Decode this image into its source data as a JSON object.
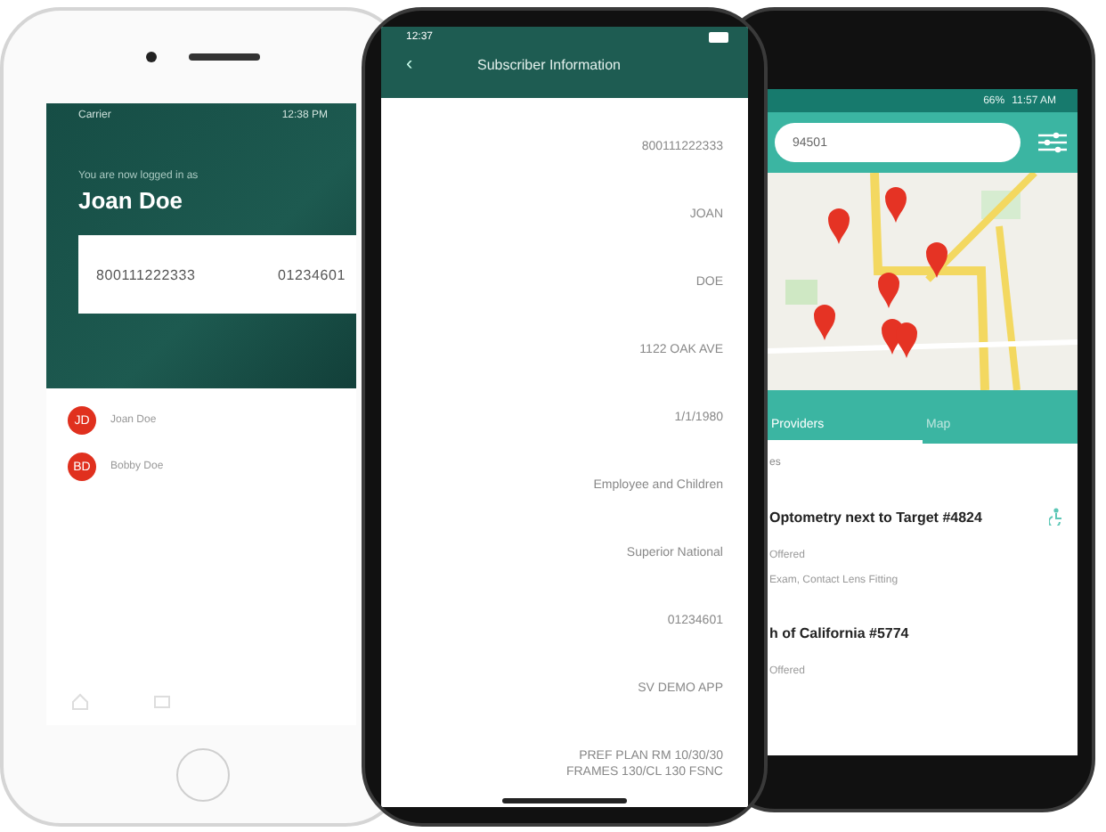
{
  "left_phone": {
    "status": {
      "carrier": "Carrier",
      "time": "12:38 PM"
    },
    "greeting": "You are now logged in as",
    "name": "Joan Doe",
    "card": {
      "member_id": "800111222333",
      "group": "01234601"
    },
    "members": [
      {
        "initials": "JD",
        "name": "Joan Doe"
      },
      {
        "initials": "BD",
        "name": "Bobby Doe"
      }
    ]
  },
  "middle_phone": {
    "time": "12:37",
    "title": "Subscriber Information",
    "back": "‹",
    "fields": [
      {
        "lines": [
          "800111222333"
        ]
      },
      {
        "lines": [
          "JOAN"
        ]
      },
      {
        "lines": [
          "DOE"
        ]
      },
      {
        "lines": [
          "1122 OAK AVE"
        ]
      },
      {
        "lines": [
          "1/1/1980"
        ]
      },
      {
        "lines": [
          "Employee and Children"
        ]
      },
      {
        "lines": [
          "Superior National"
        ]
      },
      {
        "lines": [
          "01234601"
        ]
      },
      {
        "lines": [
          "SV DEMO APP"
        ]
      },
      {
        "lines": [
          "PREF PLAN RM 10/30/30",
          "FRAMES 130/CL 130 FSNC"
        ]
      }
    ]
  },
  "right_phone": {
    "status": {
      "battery": "66%",
      "time": "11:57 AM"
    },
    "search": {
      "value": "94501"
    },
    "tabs": [
      {
        "label": "Providers",
        "selected": true
      },
      {
        "label": "Map",
        "selected": false
      }
    ],
    "section": "es",
    "providers": [
      {
        "name": "Optometry next to Target #4824",
        "status": "Offered",
        "services": "Exam, Contact Lens Fitting"
      },
      {
        "name": "h of California #5774",
        "status": "Offered"
      }
    ]
  }
}
